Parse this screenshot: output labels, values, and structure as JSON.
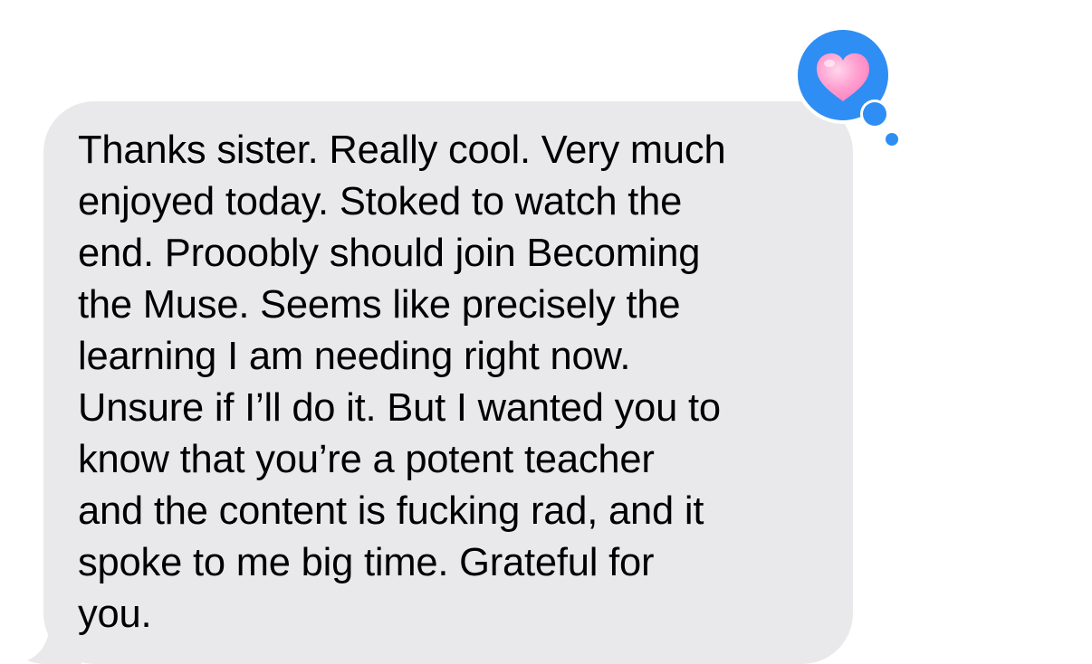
{
  "message": {
    "direction": "received",
    "lines": [
      "Thanks sister. Really cool. Very much",
      "enjoyed today. Stoked to watch the",
      "end. Prooobly should join Becoming",
      "the Muse. Seems like precisely the",
      "learning I am needing right now.",
      "Unsure if I’ll do it. But I wanted you to",
      "know that you’re a potent teacher",
      "and the content is fucking rad, and it",
      "spoke to me big time. Grateful for",
      "you."
    ],
    "bubble_color": "#e9e9eb",
    "text_color": "#000000"
  },
  "tapback": {
    "icon": "heart-icon",
    "badge_color": "#2f8ef4",
    "heart_color": "#ff9fd0"
  }
}
